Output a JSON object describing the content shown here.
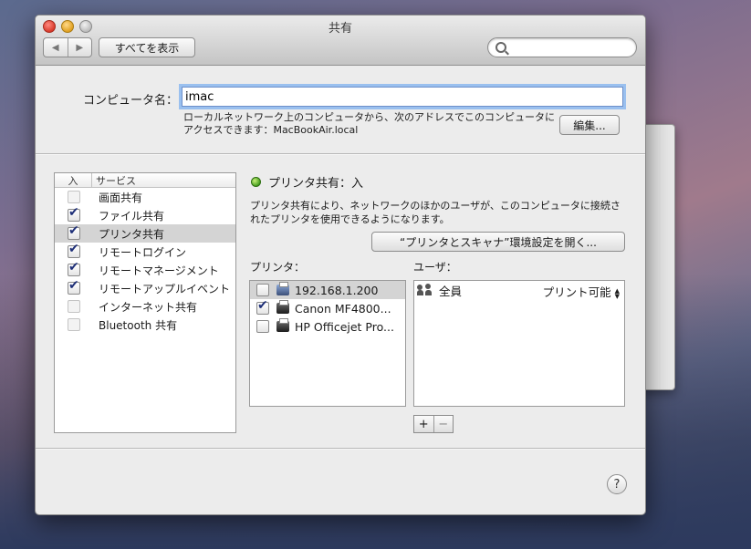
{
  "window": {
    "title": "共有"
  },
  "toolbar": {
    "back_icon": "◀",
    "forward_icon": "▶",
    "show_all_label": "すべてを表示",
    "search_placeholder": "",
    "search_value": ""
  },
  "computer": {
    "label": "コンピュータ名：",
    "name_value": "imac",
    "address_line1": "ローカルネットワーク上のコンピュータから、次のアドレスでこのコンピュータに",
    "address_line2": "アクセスできます：MacBookAir.local",
    "edit_label": "編集..."
  },
  "services": {
    "header_on": "入",
    "header_service": "サービス",
    "items": [
      {
        "label": "画面共有",
        "checked": false,
        "selected": false
      },
      {
        "label": "ファイル共有",
        "checked": true,
        "selected": false
      },
      {
        "label": "プリンタ共有",
        "checked": true,
        "selected": true
      },
      {
        "label": "リモートログイン",
        "checked": true,
        "selected": false
      },
      {
        "label": "リモートマネージメント",
        "checked": true,
        "selected": false
      },
      {
        "label": "リモートアップルイベント",
        "checked": true,
        "selected": false
      },
      {
        "label": "インターネット共有",
        "checked": false,
        "selected": false
      },
      {
        "label": "Bluetooth 共有",
        "checked": false,
        "selected": false
      }
    ]
  },
  "detail": {
    "status": "プリンタ共有：入",
    "status_color": "#3f9a1a",
    "description_line1": "プリンタ共有により、ネットワークのほかのユーザが、このコンピュータに接続さ",
    "description_line2": "れたプリンタを使用できるようになります。",
    "open_prefs_label": "“プリンタとスキャナ”環境設定を開く...",
    "printers_label": "プリンタ：",
    "users_label": "ユーザ：",
    "printers": [
      {
        "name": "192.168.1.200",
        "checked": false,
        "selected": true
      },
      {
        "name": "Canon MF4800...",
        "checked": true,
        "selected": false
      },
      {
        "name": "HP Officejet Pro...",
        "checked": false,
        "selected": false
      }
    ],
    "users": [
      {
        "name": "全員",
        "permission": "プリント可能"
      }
    ],
    "add_label": "+",
    "remove_label": "−"
  },
  "help": {
    "label": "?"
  }
}
